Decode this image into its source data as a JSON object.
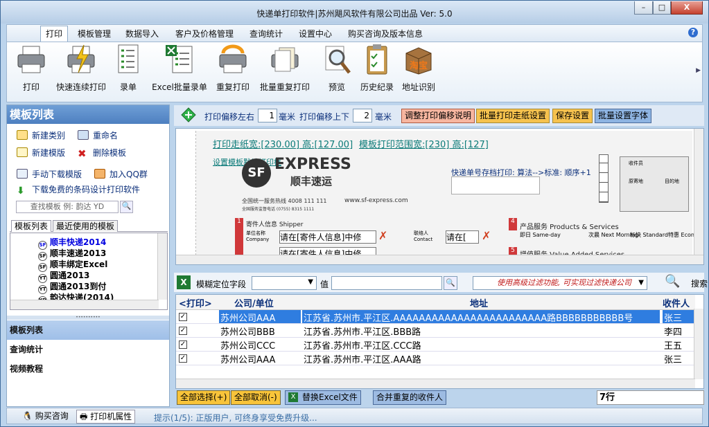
{
  "window": {
    "title": "快递单打印软件|苏州飓风软件有限公司出品  Ver: 5.0",
    "min": "–",
    "max": "□",
    "close": "X"
  },
  "menu": {
    "tabs": [
      "打印",
      "模板管理",
      "数据导入",
      "客户及价格管理",
      "查询统计",
      "设置中心",
      "购买咨询及版本信息"
    ],
    "help": "?"
  },
  "ribbon": {
    "items": [
      {
        "label": "打印",
        "icon": "printer-icon"
      },
      {
        "label": "快速连续打印",
        "icon": "fast-print-icon"
      },
      {
        "label": "录单",
        "icon": "form-icon"
      },
      {
        "label": "Excel批量录单",
        "icon": "excel-form-icon"
      },
      {
        "label": "重复打印",
        "icon": "reprint-icon"
      },
      {
        "label": "批量重复打印",
        "icon": "batch-reprint-icon"
      },
      {
        "label": "预览",
        "icon": "magnifier-icon"
      },
      {
        "label": "历史纪录",
        "icon": "clipboard-icon"
      },
      {
        "label": "地址识别",
        "icon": "box-icon"
      }
    ],
    "box_text": "淘宝"
  },
  "left": {
    "header": "模板列表",
    "actions": [
      "新建类别",
      "重命名",
      "新建模版",
      "删除模板",
      "手动下载模版",
      "加入QQ群",
      "下载免费的条码设计打印软件"
    ],
    "search_placeholder": "查找模板 例: 韵达 YD",
    "tabs": [
      "模板列表",
      "最近使用的模板"
    ],
    "tree": [
      {
        "label": "顺丰快递2014",
        "icon": "SF",
        "color": "#0000e0"
      },
      {
        "label": "顺丰速递2013",
        "icon": "SF",
        "color": "#000"
      },
      {
        "label": "顺丰绑定Excel",
        "icon": "SF",
        "color": "#000"
      },
      {
        "label": "圆通2013",
        "icon": "YT",
        "color": "#000"
      },
      {
        "label": "圆通2013到付",
        "icon": "YT",
        "color": "#000"
      },
      {
        "label": "韵达快递(2014)",
        "icon": "YD",
        "color": "#000"
      }
    ],
    "nav": [
      "模板列表",
      "查询统计",
      "视频教程"
    ]
  },
  "offsets": {
    "lr_label": "打印偏移左右",
    "lr_value": "1",
    "unit": "毫米",
    "ud_label": "打印偏移上下",
    "ud_value": "2",
    "buttons": [
      "调整打印偏移说明",
      "批量打印走纸设置",
      "保存设置",
      "批量设置字体"
    ]
  },
  "preview": {
    "paper_size": "打印走纸宽:[230.00] 高:[127.00]",
    "range_size": "模板打印范围宽:[230] 高:[127]",
    "set_range": "设置模板默认打印框",
    "archive": "快递单号存档打印: 算法-->标准: 顺序+1",
    "brand": "EXPRESS",
    "brand_cn": "顺丰速运",
    "hotline": "全国统一服务热线 4008 111 111",
    "monitor": "全国服务监督电话 (0755) 8315 1111",
    "website": "www.sf-express.com",
    "sender": "寄件人信息 Shipper",
    "company_label": "单位名称 Company",
    "field1": "请在[寄件人信息]中修",
    "contact_label": "联络人 Contact",
    "field2": "请在[",
    "field3": "请在[寄件人信息]中修",
    "service": "产品服务 Products & Services",
    "sameday": "即日 Same-day",
    "nextmorning": "次晨 Next Morning",
    "standard": "标快 Standard",
    "economy": "特惠 Econom",
    "value_added": "增值服务 Value Added Services",
    "num1": "1",
    "num4": "4",
    "num5": "5",
    "sender_label": "收件员",
    "origin": "原寄地",
    "dest": "目的地"
  },
  "filter": {
    "label": "模糊定位字段",
    "value_label": "值",
    "hint": "使用高级过滤功能, 可实现过滤快递公司",
    "search": "搜索"
  },
  "grid": {
    "headers": [
      "<打印>",
      "公司/单位",
      "地址",
      "收件人"
    ],
    "rows": [
      {
        "company": "苏州公司AAA",
        "address": "江苏省.苏州市.平江区.AAAAAAAAAAAAAAAAAAAAAAAA路BBBBBBBBBBB号",
        "name": "张三",
        "selected": true
      },
      {
        "company": "苏州公司BBB",
        "address": "江苏省.苏州市.平江区.BBB路",
        "name": "李四",
        "selected": false
      },
      {
        "company": "苏州公司CCC",
        "address": "江苏省.苏州市.平江区.CCC路",
        "name": "王五",
        "selected": false
      },
      {
        "company": "苏州公司AAA",
        "address": "江苏省.苏州市.平江区.AAA路",
        "name": "张三",
        "selected": false
      }
    ]
  },
  "bottom": {
    "buttons": [
      "全部选择(+)",
      "全部取消(-)",
      "替换Excel文件",
      "合并重复的收件人"
    ],
    "rows_count": "7行"
  },
  "status": {
    "buy": "购买咨询",
    "printer": "打印机属性",
    "tip": "提示(1/5): 正版用户, 可终身享受免费升级..."
  }
}
